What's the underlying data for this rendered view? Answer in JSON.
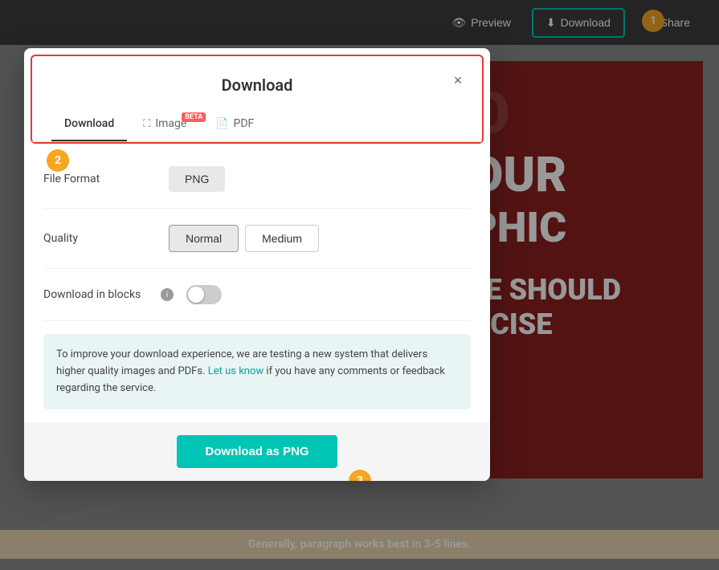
{
  "toolbar": {
    "preview_label": "Preview",
    "download_label": "Download",
    "share_label": "Share"
  },
  "modal": {
    "title": "Download",
    "close_symbol": "×",
    "tabs": [
      {
        "id": "download",
        "label": "Download",
        "active": true,
        "has_beta": false
      },
      {
        "id": "image",
        "label": "Image",
        "active": false,
        "has_beta": true
      },
      {
        "id": "pdf",
        "label": "PDF",
        "active": false,
        "has_beta": false
      }
    ],
    "file_format": {
      "label": "File Format",
      "value": "PNG"
    },
    "quality": {
      "label": "Quality",
      "normal": "Normal",
      "medium": "Medium",
      "selected": "Normal"
    },
    "download_in_blocks": {
      "label": "Download in blocks",
      "enabled": false
    },
    "info_text_1": "To improve your download experience, we are testing a new system that delivers higher quality images and PDFs.",
    "info_link_text": "Let us know",
    "info_text_2": " if you have any comments or feedback regarding the service.",
    "download_btn_label": "Download as PNG"
  },
  "canvas": {
    "text1": "O",
    "text2": "OUR",
    "text3": "PHIC",
    "text4": "LE SHOULD",
    "text5": "NCISE",
    "bottom_text": "Generally, paragraph works best in 3-5 lines."
  },
  "steps": {
    "s1": "1",
    "s2": "2",
    "s3": "3"
  },
  "watermarks": [
    "SortingperepairCom",
    "SortingperepairCom",
    "SortingperepairCom"
  ]
}
